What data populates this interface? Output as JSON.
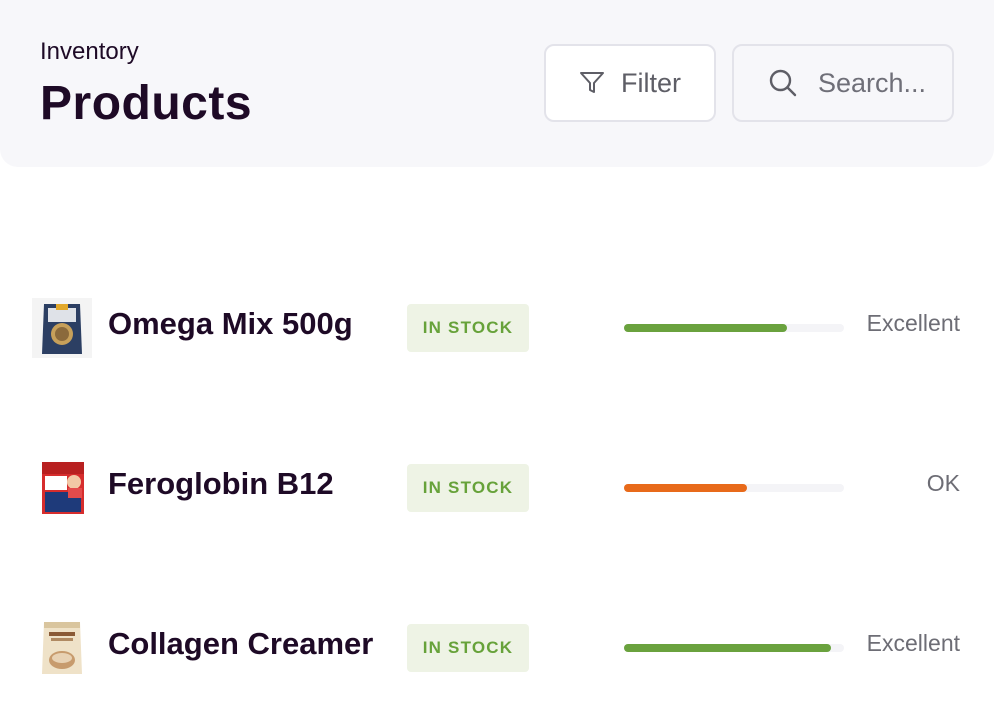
{
  "header": {
    "subtitle": "Inventory",
    "title": "Products",
    "filter_label": "Filter",
    "search_placeholder": "Search..."
  },
  "products": [
    {
      "name": "Omega Mix 500g",
      "status": "IN STOCK",
      "score_fraction": 0.74,
      "bar_color": "#6aa23e",
      "rating": "Excellent",
      "thumb": {
        "primary": "#2c3f63",
        "accent": "#e3a92b",
        "label": "Omega"
      }
    },
    {
      "name": "Feroglobin B12",
      "status": "IN STOCK",
      "score_fraction": 0.56,
      "bar_color": "#e86a1a",
      "rating": "OK",
      "thumb": {
        "primary": "#d62d2d",
        "accent": "#1e3a7a",
        "label": "Feroglobin"
      }
    },
    {
      "name": "Collagen Creamer",
      "status": "IN STOCK",
      "score_fraction": 0.94,
      "bar_color": "#6aa23e",
      "rating": "Excellent",
      "thumb": {
        "primary": "#efe2c8",
        "accent": "#8a5a36",
        "label": "Collagen"
      }
    }
  ],
  "colors": {
    "text_dark": "#1e0a26",
    "badge_bg": "#eef3e5",
    "badge_text": "#67a23a",
    "good": "#6aa23e",
    "ok": "#e86a1a"
  }
}
